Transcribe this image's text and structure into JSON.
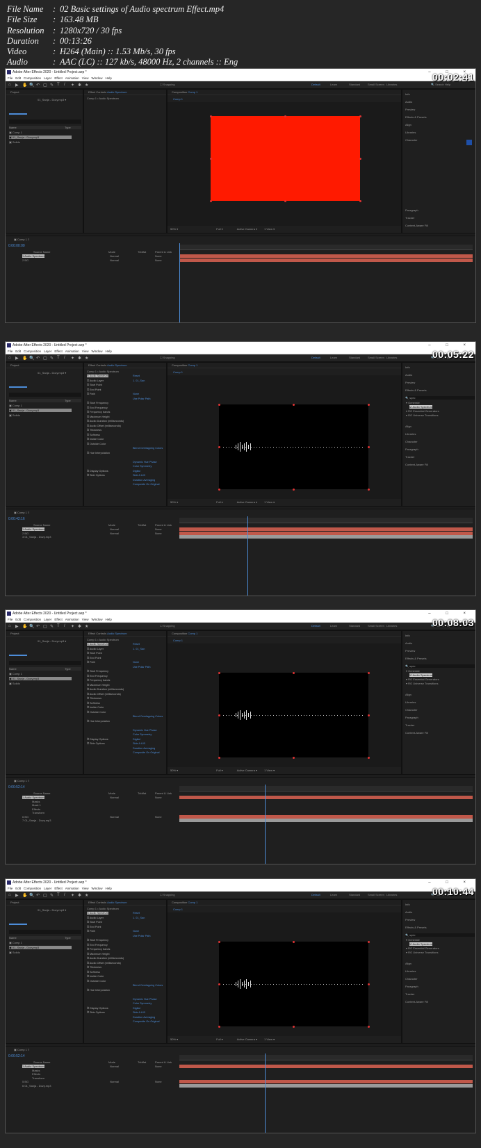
{
  "file_info": [
    {
      "key": "File Name",
      "value": "02 Basic settings of Audio spectrum Effect.mp4"
    },
    {
      "key": "File Size",
      "value": "163.48 MB"
    },
    {
      "key": "Resolution",
      "value": "1280x720 / 30 fps"
    },
    {
      "key": "Duration",
      "value": "00:13:26"
    },
    {
      "key": "Video",
      "value": "H264 (Main) :: 1.53 Mb/s, 30 fps"
    },
    {
      "key": "Audio",
      "value": "AAC (LC) :: 127 kb/s, 48000 Hz, 2 channels :: Eng"
    }
  ],
  "app": {
    "title": "Adobe After Effects 2020 - Untitled Project.aep *",
    "menu": [
      "File",
      "Edit",
      "Composition",
      "Layer",
      "Effect",
      "Animation",
      "View",
      "Window",
      "Help"
    ],
    "workspaces": [
      "Default",
      "Learn",
      "Standard",
      "Small Screen",
      "Libraries"
    ],
    "search_help": "Search Help",
    "snapping": "Snapping",
    "project_tab": "Project",
    "project_selected": "01_Sanja - Dozy.mp3",
    "project_items": [
      "Comp 1",
      "01_Sanja - Dozy.mp3",
      "Solids"
    ],
    "project_cols": [
      "Name",
      "Type"
    ],
    "effect_controls_tab": "Effect Controls",
    "effect_layer": "Audio Spectrum",
    "effect_breadcrumb": "Comp 1 • Audio Spectrum",
    "composition_tab": "Composition",
    "comp_name": "Comp 1",
    "zoom": "50%",
    "resolution": "Full",
    "camera": "Active Camera",
    "views": "1 View",
    "timeline_tab": "Comp 1",
    "layer_cols": [
      "Source Name",
      "Mode",
      "TrkMat",
      "Parent & Link"
    ],
    "mode": "Normal",
    "parent": "None"
  },
  "effect_props": [
    {
      "label": "Audio Spectrum",
      "value": "Reset"
    },
    {
      "label": "Audio Layer",
      "value": "1. 01_San"
    },
    {
      "label": "Start Point",
      "value": ""
    },
    {
      "label": "End Point",
      "value": ""
    },
    {
      "label": "Path",
      "value": "None"
    },
    {
      "label": "",
      "value": "Use Polar Path"
    },
    {
      "label": "Start Frequency",
      "value": ""
    },
    {
      "label": "End Frequency",
      "value": ""
    },
    {
      "label": "Frequency bands",
      "value": ""
    },
    {
      "label": "Maximum Height",
      "value": ""
    },
    {
      "label": "Audio Duration (milliseconds)",
      "value": ""
    },
    {
      "label": "Audio Offset (milliseconds)",
      "value": ""
    },
    {
      "label": "Thickness",
      "value": ""
    },
    {
      "label": "Softness",
      "value": ""
    },
    {
      "label": "Inside Color",
      "value": ""
    },
    {
      "label": "Outside Color",
      "value": ""
    },
    {
      "label": "",
      "value": "Blend Overlapping Colors"
    },
    {
      "label": "Hue Interpolation",
      "value": ""
    },
    {
      "label": "",
      "value": ""
    },
    {
      "label": "",
      "value": "Dynamic Hue Phase"
    },
    {
      "label": "",
      "value": "Color Symmetry"
    },
    {
      "label": "Display Options",
      "value": "Digital"
    },
    {
      "label": "Side Options",
      "value": "Side A & B"
    },
    {
      "label": "",
      "value": "Duration Averaging"
    },
    {
      "label": "",
      "value": "Composite On Original"
    }
  ],
  "right_panel_basic": [
    "Info",
    "Audio",
    "Preview",
    "Effects & Presets",
    "Align",
    "Libraries",
    "Character",
    "Paragraph",
    "Tracker",
    "Content-Aware Fill"
  ],
  "right_panel_effects": {
    "top": [
      "Info",
      "Audio",
      "Preview",
      "Effects & Presets"
    ],
    "search": "spec",
    "results": [
      "Generate",
      "Audio Spectrum",
      "RG Essential Generators",
      "RG Universe Transitions"
    ],
    "bottom": [
      "Align",
      "Libraries",
      "Character",
      "Paragraph",
      "Tracker",
      "Content-Aware Fill"
    ]
  },
  "frames": [
    {
      "timestamp": "00:02:41",
      "timecode": "0:00:00:00",
      "content": "red-solid",
      "effects": false,
      "layers": [
        "Audio Spectrum",
        "BG"
      ],
      "playhead": 0.0
    },
    {
      "timestamp": "00:05:22",
      "timecode": "0:00:42:16",
      "content": "spectrum",
      "effects": true,
      "layers": [
        "Audio Spectrum",
        "BG",
        "01_Sanja - Dozy.mp3"
      ],
      "playhead": 0.23
    },
    {
      "timestamp": "00:08:03",
      "timecode": "0:00:52:14",
      "content": "spectrum",
      "effects": true,
      "layers": [
        "Audio Spectrum",
        "Masks",
        "Mask 1",
        "Effects",
        "Transform",
        "BG",
        "01_Sanja - Dozy.mp3"
      ],
      "playhead": 0.29
    },
    {
      "timestamp": "00:10:44",
      "timecode": "0:00:52:14",
      "content": "spectrum",
      "effects": true,
      "layers": [
        "Audio Spectrum",
        "Masks",
        "Effects",
        "Transform",
        "BG",
        "01_Sanja - Dozy.mp3"
      ],
      "playhead": 0.29
    }
  ],
  "colors": {
    "accent": "#4d8dd9",
    "solid": "#ff1a00",
    "layer_bar": "#c0584a",
    "audio_bar": "#9a9a9a"
  }
}
